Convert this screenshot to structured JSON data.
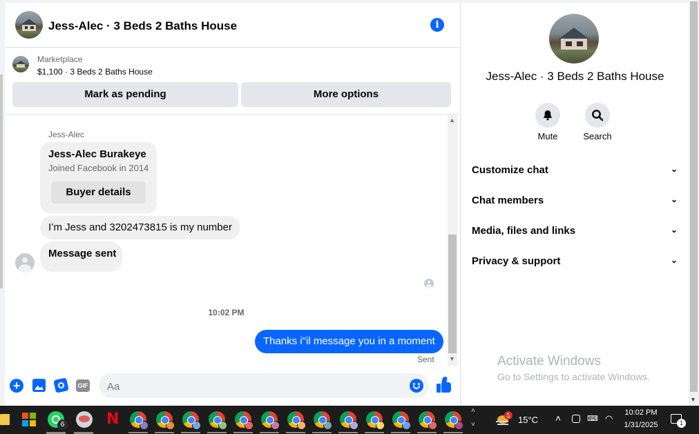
{
  "header": {
    "title": "Jess-Alec · 3 Beds 2 Baths House",
    "info_icon": "i"
  },
  "marketplace": {
    "label": "Marketplace",
    "listing": "$1,100 · 3 Beds 2 Baths House",
    "pending_button": "Mark as pending",
    "more_button": "More options"
  },
  "chat": {
    "sender_name": "Jess-Alec",
    "profile_card": {
      "name": "Jess-Alec Burakeye",
      "joined": "Joined Facebook in 2014",
      "button": "Buyer details"
    },
    "messages_in": [
      "I’m Jess and 3202473815 is my number",
      "Message sent"
    ],
    "timestamp": "10:02 PM",
    "message_out": "Thanks i\"il message you in a moment",
    "status": "Sent"
  },
  "composer": {
    "placeholder": "Aa"
  },
  "side_panel": {
    "title": "Jess-Alec · 3 Beds 2 Baths House",
    "mute_label": "Mute",
    "search_label": "Search",
    "sections": [
      "Customize chat",
      "Chat members",
      "Media, files and links",
      "Privacy & support"
    ]
  },
  "watermark": {
    "title": "Activate Windows",
    "subtitle": "Go to Settings to activate Windows."
  },
  "taskbar": {
    "whatsapp_badge": "6",
    "weather_badge": "1",
    "temperature": "15°C",
    "time": "10:02 PM",
    "date": "1/31/2025",
    "notification_count": "1"
  }
}
